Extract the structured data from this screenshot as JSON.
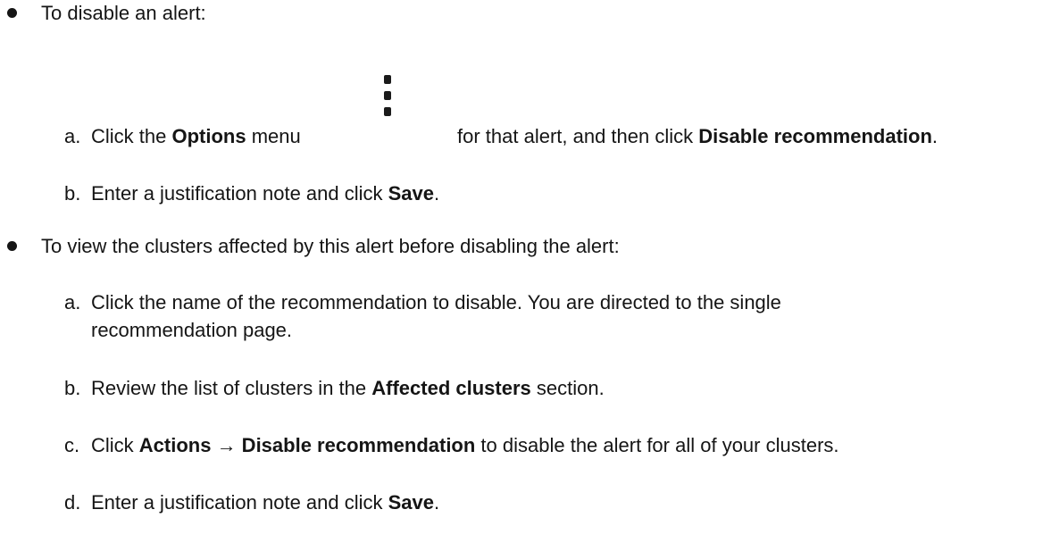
{
  "bullets": [
    {
      "intro": "To disable an alert:",
      "steps": [
        {
          "marker": "a.",
          "t1": "Click the ",
          "b1": "Options",
          "t2": " menu",
          "t3": "for that alert, and then click ",
          "b2": "Disable recommendation",
          "t4": "."
        },
        {
          "marker": "b.",
          "t1": "Enter a justification note and click ",
          "b1": "Save",
          "t2": "."
        }
      ]
    },
    {
      "intro": "To view the clusters affected by this alert before disabling the alert:",
      "steps": [
        {
          "marker": "a.",
          "line1": "Click the name of the recommendation to disable. You are directed to the single",
          "line2": "recommendation page."
        },
        {
          "marker": "b.",
          "t1": "Review the list of clusters in the ",
          "b1": "Affected clusters",
          "t2": " section."
        },
        {
          "marker": "c.",
          "t1": "Click ",
          "b1": "Actions → Disable recommendation",
          "t2": " to disable the alert for all of your clusters."
        },
        {
          "marker": "d.",
          "t1": "Enter a justification note and click ",
          "b1": "Save",
          "t2": "."
        }
      ]
    }
  ],
  "icons": {
    "options_menu": "kebab-vertical-icon"
  }
}
